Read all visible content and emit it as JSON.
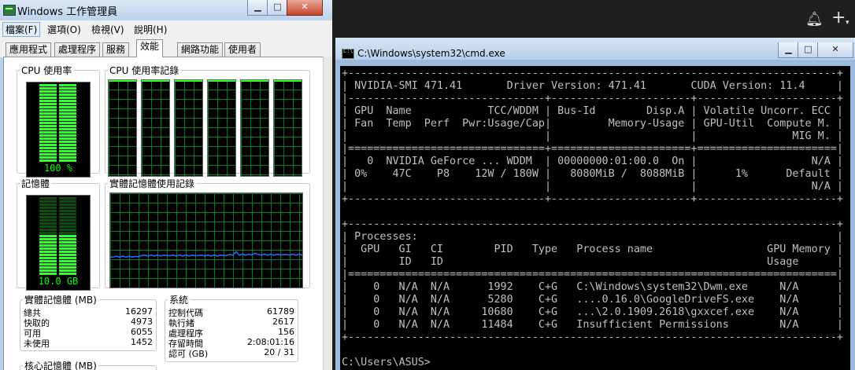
{
  "taskmgr": {
    "title": "Windows 工作管理員",
    "menu": [
      "檔案(F)",
      "選項(O)",
      "檢視(V)",
      "說明(H)"
    ],
    "tabs": [
      "應用程式",
      "處理程序",
      "服務",
      "效能",
      "網路功能",
      "使用者"
    ],
    "active_tab": 3,
    "perf": {
      "cpu_label": "CPU 使用率",
      "cpu_value": "100 %",
      "cpu_fraction": 1.0,
      "cpu_history_label": "CPU 使用率記錄",
      "cpu_cores": 6,
      "mem_label": "記憶體",
      "mem_value": "10.0 GB",
      "mem_fraction": 0.5,
      "mem_history_label": "實體記憶體使用記錄",
      "mem_history_level": 0.34,
      "physical_mem_title": "實體記憶體 (MB)",
      "physical_mem": [
        {
          "k": "總共",
          "v": "16297"
        },
        {
          "k": "快取的",
          "v": "4973"
        },
        {
          "k": "可用",
          "v": "6055"
        },
        {
          "k": "未使用",
          "v": "1452"
        }
      ],
      "system_title": "系統",
      "system": [
        {
          "k": "控制代碼",
          "v": "61789"
        },
        {
          "k": "執行緒",
          "v": "2617"
        },
        {
          "k": "處理程序",
          "v": "156"
        },
        {
          "k": "存留時間",
          "v": "2:08:01:16"
        },
        {
          "k": "認可 (GB)",
          "v": "20 / 31"
        }
      ],
      "kernel_mem_title": "核心記憶體 (MB)"
    }
  },
  "gap_icons": [
    "bell-icon",
    "plus-icon"
  ],
  "cmd": {
    "title": "C:\\Windows\\system32\\cmd.exe",
    "console_lines": [
      "+-----------------------------------------------------------------------------+",
      "| NVIDIA-SMI 471.41       Driver Version: 471.41       CUDA Version: 11.4     |",
      "|-------------------------------+----------------------+----------------------+",
      "| GPU  Name            TCC/WDDM | Bus-Id        Disp.A | Volatile Uncorr. ECC |",
      "| Fan  Temp  Perf  Pwr:Usage/Cap|         Memory-Usage | GPU-Util  Compute M. |",
      "|                               |                      |               MIG M. |",
      "|===============================+======================+======================|",
      "|   0  NVIDIA GeForce ... WDDM  | 00000000:01:00.0  On |                  N/A |",
      "| 0%    47C    P8    12W / 180W |   8080MiB /  8088MiB |      1%      Default |",
      "|                               |                      |                  N/A |",
      "+-------------------------------+----------------------+----------------------+",
      "",
      "+-----------------------------------------------------------------------------+",
      "| Processes:                                                                  |",
      "|  GPU   GI   CI        PID   Type   Process name                  GPU Memory |",
      "|        ID   ID                                                   Usage      |",
      "|=============================================================================|",
      "|    0   N/A  N/A      1992    C+G   C:\\Windows\\system32\\Dwm.exe     N/A      |",
      "|    0   N/A  N/A      5280    C+G   ....0.16.0\\GoogleDriveFS.exe    N/A      |",
      "|    0   N/A  N/A     10680    C+G   ...\\2.0.1909.2618\\gxxcef.exe    N/A      |",
      "|    0   N/A  N/A     11484    C+G   Insufficient Permissions        N/A      |",
      "+-----------------------------------------------------------------------------+",
      "",
      "C:\\Users\\ASUS>"
    ]
  }
}
